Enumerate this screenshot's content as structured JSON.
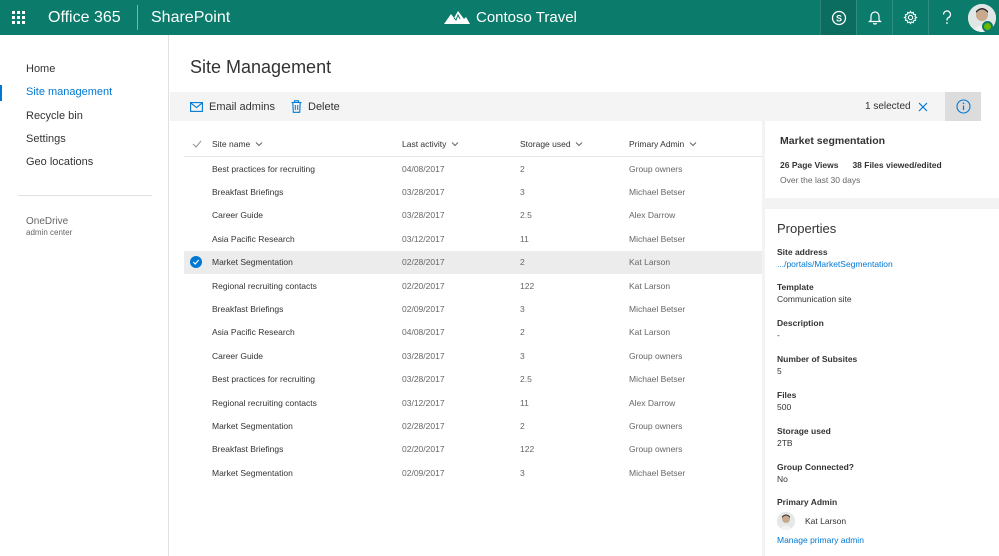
{
  "suite": {
    "brand": "Office 365",
    "app": "SharePoint",
    "site_name": "Contoso Travel"
  },
  "leftnav": {
    "items": [
      {
        "label": "Home"
      },
      {
        "label": "Site management"
      },
      {
        "label": "Recycle bin"
      },
      {
        "label": "Settings"
      },
      {
        "label": "Geo locations"
      }
    ],
    "selected_index": 1,
    "onedrive_title": "OneDrive",
    "onedrive_sub": "admin center"
  },
  "main": {
    "title": "Site Management",
    "commands": {
      "email_admins": "Email admins",
      "delete": "Delete"
    },
    "selection_text": "1 selected"
  },
  "table": {
    "columns": [
      "Site name",
      "Last activity",
      "Storage used",
      "Primary Admin"
    ],
    "rows": [
      {
        "name": "Best practices for recruiting",
        "activity": "04/08/2017",
        "storage": "2",
        "admin": "Group owners",
        "selected": false
      },
      {
        "name": "Breakfast Briefings",
        "activity": "03/28/2017",
        "storage": "3",
        "admin": "Michael Betser",
        "selected": false
      },
      {
        "name": "Career Guide",
        "activity": "03/28/2017",
        "storage": "2.5",
        "admin": "Alex Darrow",
        "selected": false
      },
      {
        "name": "Asia Pacific Research",
        "activity": "03/12/2017",
        "storage": "11",
        "admin": "Michael Betser",
        "selected": false
      },
      {
        "name": "Market Segmentation",
        "activity": "02/28/2017",
        "storage": "2",
        "admin": "Kat Larson",
        "selected": true
      },
      {
        "name": "Regional recruiting contacts",
        "activity": "02/20/2017",
        "storage": "122",
        "admin": "Kat Larson",
        "selected": false
      },
      {
        "name": "Breakfast Briefings",
        "activity": "02/09/2017",
        "storage": "3",
        "admin": "Michael Betser",
        "selected": false
      },
      {
        "name": "Asia Pacific Research",
        "activity": "04/08/2017",
        "storage": "2",
        "admin": "Kat Larson",
        "selected": false
      },
      {
        "name": "Career Guide",
        "activity": "03/28/2017",
        "storage": "3",
        "admin": "Group owners",
        "selected": false
      },
      {
        "name": "Best practices for recruiting",
        "activity": "03/28/2017",
        "storage": "2.5",
        "admin": "Michael Betser",
        "selected": false
      },
      {
        "name": "Regional recruiting contacts",
        "activity": "03/12/2017",
        "storage": "11",
        "admin": "Alex Darrow",
        "selected": false
      },
      {
        "name": "Market Segmentation",
        "activity": "02/28/2017",
        "storage": "2",
        "admin": "Group owners",
        "selected": false
      },
      {
        "name": "Breakfast Briefings",
        "activity": "02/20/2017",
        "storage": "122",
        "admin": "Group owners",
        "selected": false
      },
      {
        "name": "Market Segmentation",
        "activity": "02/09/2017",
        "storage": "3",
        "admin": "Michael Betser",
        "selected": false
      }
    ]
  },
  "panel": {
    "title": "Market segmentation",
    "page_views": "26 Page Views",
    "files_viewed": "38 Files viewed/edited",
    "period": "Over the last 30 days",
    "properties_heading": "Properties",
    "properties": [
      {
        "label": "Site address",
        "value": ".../portals/MarketSegmentation",
        "link": true
      },
      {
        "label": "Template",
        "value": "Communication site",
        "link": false
      },
      {
        "label": "Description",
        "value": "-",
        "link": false
      },
      {
        "label": "Number of Subsites",
        "value": "5",
        "link": false
      },
      {
        "label": "Files",
        "value": "500",
        "link": false
      },
      {
        "label": "Storage used",
        "value": "2TB",
        "link": false
      },
      {
        "label": "Group Connected?",
        "value": "No",
        "link": false
      }
    ],
    "primary_admin_label": "Primary Admin",
    "primary_admin_name": "Kat Larson",
    "manage_link": "Manage primary admin"
  },
  "colors": {
    "suite_bar": "#0b7b6c",
    "accent": "#0078d4",
    "status_online": "#6bb700"
  }
}
